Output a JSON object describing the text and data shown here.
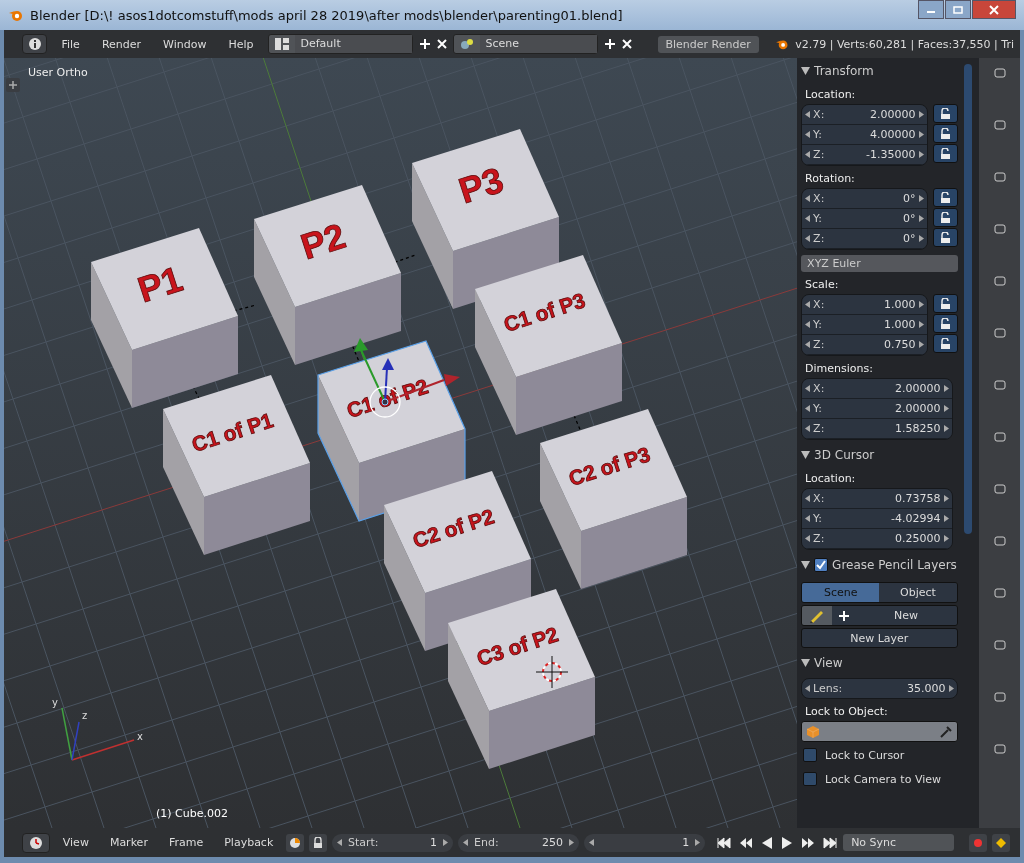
{
  "window": {
    "title": "Blender [D:\\! asos1dotcomstuff\\mods april 28 2019\\after mods\\blender\\parenting01.blend]"
  },
  "header": {
    "menus": [
      "File",
      "Render",
      "Window",
      "Help"
    ],
    "layout": "Default",
    "scene": "Scene",
    "engine": "Blender Render",
    "stats": "v2.79 | Verts:60,281 | Faces:37,550 | Tri"
  },
  "viewport": {
    "view_label": "User Ortho",
    "object_label": "(1) Cube.002",
    "cubes": [
      {
        "label": "P1",
        "selected": false
      },
      {
        "label": "P2",
        "selected": false
      },
      {
        "label": "P3",
        "selected": false
      },
      {
        "label": "C1 of P1",
        "selected": false
      },
      {
        "label": "C1 of P2",
        "selected": true
      },
      {
        "label": "C1 of P3",
        "selected": false
      },
      {
        "label": "C2 of P2",
        "selected": false
      },
      {
        "label": "C2 of P3",
        "selected": false
      },
      {
        "label": "C3 of P2",
        "selected": false
      }
    ],
    "axes": {
      "x": "x",
      "y": "y",
      "z": "z"
    }
  },
  "transform": {
    "title": "Transform",
    "groups": [
      {
        "label": "Location:",
        "lockable": true,
        "fields": [
          {
            "axis": "X:",
            "value": "2.00000"
          },
          {
            "axis": "Y:",
            "value": "4.00000"
          },
          {
            "axis": "Z:",
            "value": "-1.35000"
          }
        ]
      },
      {
        "label": "Rotation:",
        "lockable": true,
        "fields": [
          {
            "axis": "X:",
            "value": "0°"
          },
          {
            "axis": "Y:",
            "value": "0°"
          },
          {
            "axis": "Z:",
            "value": "0°"
          }
        ],
        "mode": "XYZ Euler"
      },
      {
        "label": "Scale:",
        "lockable": true,
        "fields": [
          {
            "axis": "X:",
            "value": "1.000"
          },
          {
            "axis": "Y:",
            "value": "1.000"
          },
          {
            "axis": "Z:",
            "value": "0.750"
          }
        ]
      },
      {
        "label": "Dimensions:",
        "lockable": false,
        "fields": [
          {
            "axis": "X:",
            "value": "2.00000"
          },
          {
            "axis": "Y:",
            "value": "2.00000"
          },
          {
            "axis": "Z:",
            "value": "1.58250"
          }
        ]
      }
    ]
  },
  "cursor": {
    "title": "3D Cursor",
    "groups": [
      {
        "label": "Location:",
        "lockable": false,
        "fields": [
          {
            "axis": "X:",
            "value": "0.73758"
          },
          {
            "axis": "Y:",
            "value": "-4.02994"
          },
          {
            "axis": "Z:",
            "value": "0.25000"
          }
        ]
      }
    ]
  },
  "grease_pencil": {
    "title": "Grease Pencil Layers",
    "enabled": true,
    "tabs": [
      {
        "label": "Scene",
        "selected": true
      },
      {
        "label": "Object",
        "selected": false
      }
    ],
    "new_button": "New",
    "new_layer_button": "New Layer"
  },
  "view": {
    "title": "View",
    "lens_label": "Lens:",
    "lens_value": "35.000",
    "lock_label": "Lock to Object:",
    "checks": [
      {
        "label": "Lock to Cursor",
        "checked": false
      },
      {
        "label": "Lock Camera to View",
        "checked": false
      }
    ]
  },
  "timeline": {
    "menus": [
      "View",
      "Marker",
      "Frame",
      "Playback"
    ],
    "start_label": "Start:",
    "start": "1",
    "end_label": "End:",
    "end": "250",
    "frame": "1",
    "sync": "No Sync"
  }
}
